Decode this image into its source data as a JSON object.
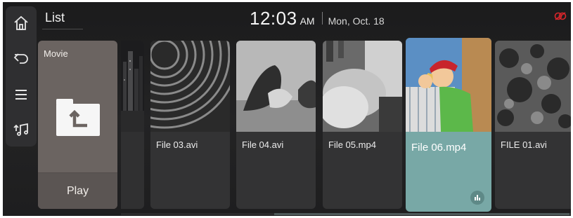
{
  "header": {
    "title": "List",
    "time": "12:03",
    "ampm": "AM",
    "date": "Mon, Oct. 18"
  },
  "rail": {
    "items": [
      {
        "icon": "home-icon"
      },
      {
        "icon": "back-icon"
      },
      {
        "icon": "menu-icon"
      },
      {
        "icon": "music-source-icon"
      }
    ]
  },
  "status": {
    "icon": "phone-disconnected-icon",
    "color": "#d9262b"
  },
  "folder": {
    "label": "Movie",
    "icon": "folder-up-icon",
    "play_label": "Play"
  },
  "files": [
    {
      "name": "File 03.avi",
      "selected": false
    },
    {
      "name": "File 04.avi",
      "selected": false
    },
    {
      "name": "File 05.mp4",
      "selected": false
    },
    {
      "name": "File 06.mp4",
      "selected": true
    },
    {
      "name": "FILE 01.avi",
      "selected": false
    }
  ],
  "colors": {
    "background": "#1e1e1f",
    "folder_card": "#6b6461",
    "selected_card": "#78a8a6",
    "card": "#333334"
  }
}
